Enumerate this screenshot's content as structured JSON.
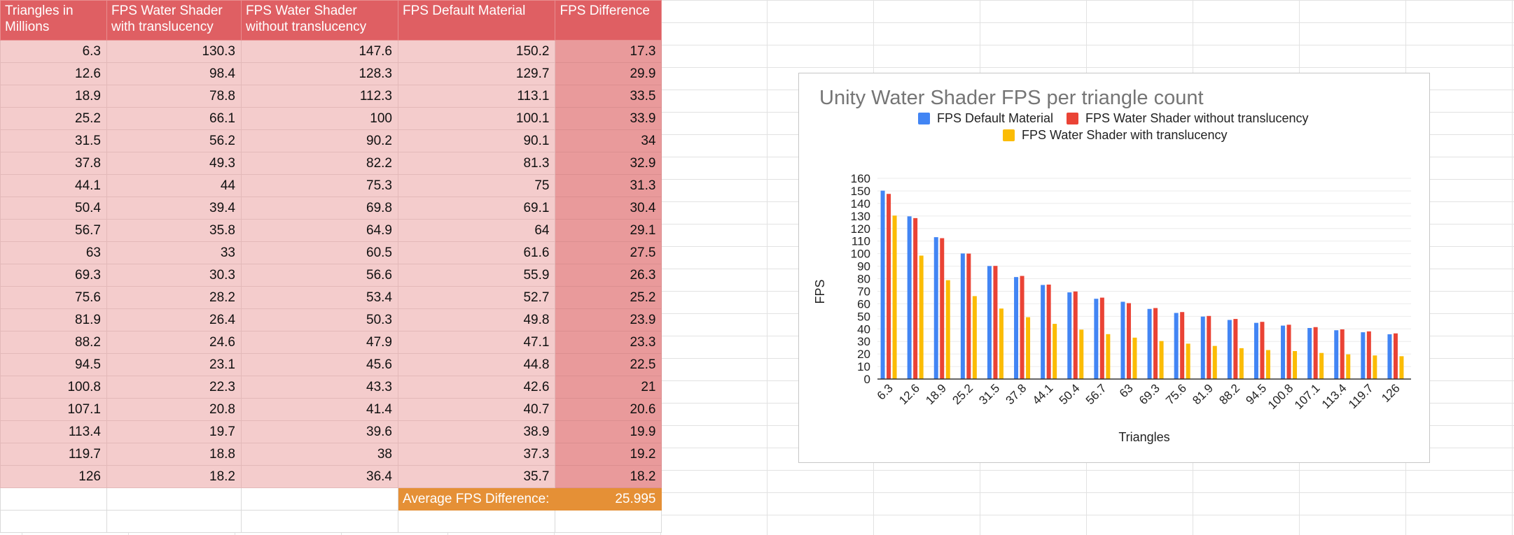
{
  "sheet": {
    "headers": [
      "Triangles in Millions",
      "FPS Water Shader with translucency",
      "FPS Water Shader without translucency",
      "FPS Default Material",
      "FPS Difference"
    ],
    "rows": [
      [
        "6.3",
        "130.3",
        "147.6",
        "150.2",
        "17.3"
      ],
      [
        "12.6",
        "98.4",
        "128.3",
        "129.7",
        "29.9"
      ],
      [
        "18.9",
        "78.8",
        "112.3",
        "113.1",
        "33.5"
      ],
      [
        "25.2",
        "66.1",
        "100",
        "100.1",
        "33.9"
      ],
      [
        "31.5",
        "56.2",
        "90.2",
        "90.1",
        "34"
      ],
      [
        "37.8",
        "49.3",
        "82.2",
        "81.3",
        "32.9"
      ],
      [
        "44.1",
        "44",
        "75.3",
        "75",
        "31.3"
      ],
      [
        "50.4",
        "39.4",
        "69.8",
        "69.1",
        "30.4"
      ],
      [
        "56.7",
        "35.8",
        "64.9",
        "64",
        "29.1"
      ],
      [
        "63",
        "33",
        "60.5",
        "61.6",
        "27.5"
      ],
      [
        "69.3",
        "30.3",
        "56.6",
        "55.9",
        "26.3"
      ],
      [
        "75.6",
        "28.2",
        "53.4",
        "52.7",
        "25.2"
      ],
      [
        "81.9",
        "26.4",
        "50.3",
        "49.8",
        "23.9"
      ],
      [
        "88.2",
        "24.6",
        "47.9",
        "47.1",
        "23.3"
      ],
      [
        "94.5",
        "23.1",
        "45.6",
        "44.8",
        "22.5"
      ],
      [
        "100.8",
        "22.3",
        "43.3",
        "42.6",
        "21"
      ],
      [
        "107.1",
        "20.8",
        "41.4",
        "40.7",
        "20.6"
      ],
      [
        "113.4",
        "19.7",
        "39.6",
        "38.9",
        "19.9"
      ],
      [
        "119.7",
        "18.8",
        "38",
        "37.3",
        "19.2"
      ],
      [
        "126",
        "18.2",
        "36.4",
        "35.7",
        "18.2"
      ]
    ],
    "summary": {
      "label": "Average FPS Difference:",
      "value": "25.995"
    },
    "colors": {
      "header_fill": "#df5f63",
      "data_fill": "#f4cccc",
      "difference_fill": "#e99a9b",
      "summary_fill": "#e59036"
    }
  },
  "chart_data": {
    "type": "bar",
    "title": "Unity Water Shader FPS per triangle count",
    "xlabel": "Triangles",
    "ylabel": "FPS",
    "legend_position": "top",
    "grid": true,
    "ylim": [
      0,
      160
    ],
    "yticks": [
      0,
      10,
      20,
      30,
      40,
      50,
      60,
      70,
      80,
      90,
      100,
      110,
      120,
      130,
      140,
      150,
      160
    ],
    "categories": [
      "6.3",
      "12.6",
      "18.9",
      "25.2",
      "31.5",
      "37.8",
      "44.1",
      "50.4",
      "56.7",
      "63",
      "69.3",
      "75.6",
      "81.9",
      "88.2",
      "94.5",
      "100.8",
      "107.1",
      "113.4",
      "119.7",
      "126"
    ],
    "series": [
      {
        "name": "FPS Default Material",
        "color": "#4285f4",
        "values": [
          150.2,
          129.7,
          113.1,
          100.1,
          90.1,
          81.3,
          75,
          69.1,
          64,
          61.6,
          55.9,
          52.7,
          49.8,
          47.1,
          44.8,
          42.6,
          40.7,
          38.9,
          37.3,
          35.7
        ]
      },
      {
        "name": "FPS Water Shader without translucency",
        "color": "#ea4335",
        "values": [
          147.6,
          128.3,
          112.3,
          100,
          90.2,
          82.2,
          75.3,
          69.8,
          64.9,
          60.5,
          56.6,
          53.4,
          50.3,
          47.9,
          45.6,
          43.3,
          41.4,
          39.6,
          38,
          36.4
        ]
      },
      {
        "name": "FPS Water Shader with translucency",
        "color": "#fbbc04",
        "values": [
          130.3,
          98.4,
          78.8,
          66.1,
          56.2,
          49.3,
          44,
          39.4,
          35.8,
          33,
          30.3,
          28.2,
          26.4,
          24.6,
          23.1,
          22.3,
          20.8,
          19.7,
          18.8,
          18.2
        ]
      }
    ]
  }
}
